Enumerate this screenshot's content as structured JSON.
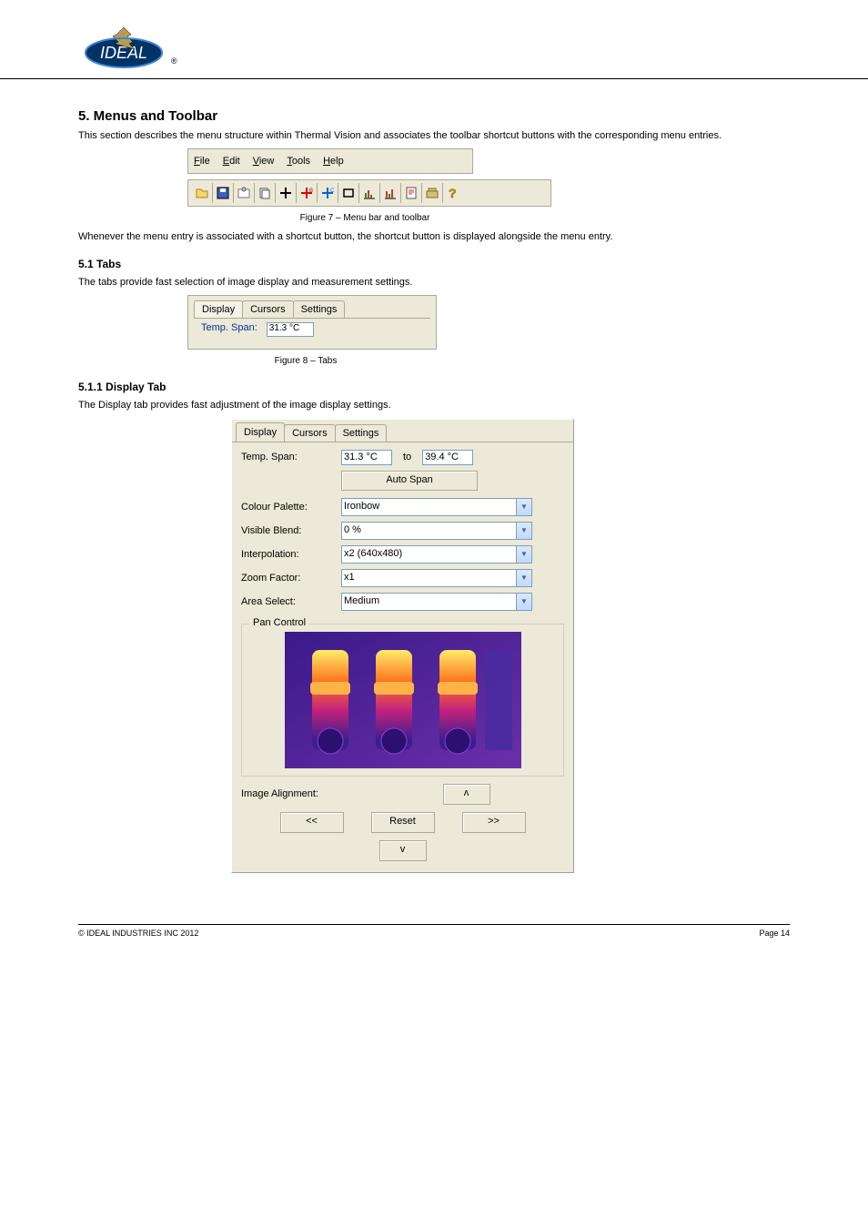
{
  "header": {
    "logo_label": "IDEAL"
  },
  "section1": {
    "title": "5. Menus and Toolbar",
    "p1": "This section describes the menu structure within Thermal Vision and associates the toolbar shortcut buttons with the corresponding menu entries."
  },
  "menubar": {
    "file": "File",
    "edit": "Edit",
    "view": "View",
    "tools": "Tools",
    "help": "Help"
  },
  "toolbar_brief": {
    "p1": "Figure 7 – Menu bar and toolbar",
    "note": "Whenever the menu entry is associated with a shortcut button, the shortcut button is displayed alongside the menu entry."
  },
  "tabs_section": {
    "title": "5.1 Tabs",
    "p1": "The tabs provide fast selection of image display and measurement settings."
  },
  "tabs": {
    "display": "Display",
    "cursors": "Cursors",
    "settings": "Settings"
  },
  "tabs_cropped": {
    "label": "Temp. Span:",
    "value_cut": "31.3 °C"
  },
  "tabs_brief": {
    "p1": "Figure 8 – Tabs",
    "t1": "5.1.1 Display Tab",
    "t1p": "The Display tab provides fast adjustment of the image display settings."
  },
  "display_panel": {
    "tabs": {
      "display": "Display",
      "cursors": "Cursors",
      "settings": "Settings"
    },
    "temp_span_label": "Temp. Span:",
    "temp_from": "31.3 °C",
    "temp_to_label": "to",
    "temp_to": "39.4 °C",
    "auto_span": "Auto Span",
    "colour_palette_label": "Colour Palette:",
    "colour_palette": "Ironbow",
    "visible_blend_label": "Visible Blend:",
    "visible_blend": "0 %",
    "interpolation_label": "Interpolation:",
    "interpolation": "x2 (640x480)",
    "zoom_label": "Zoom Factor:",
    "zoom": "x1",
    "area_label": "Area Select:",
    "area": "Medium",
    "pan_legend": "Pan Control",
    "align_label": "Image Alignment:",
    "btn_up": "ʌ",
    "btn_left": "<<",
    "btn_reset": "Reset",
    "btn_right": ">>",
    "btn_down": "v"
  },
  "footer": {
    "left": "© IDEAL INDUSTRIES INC 2012",
    "right": "Page 14"
  }
}
